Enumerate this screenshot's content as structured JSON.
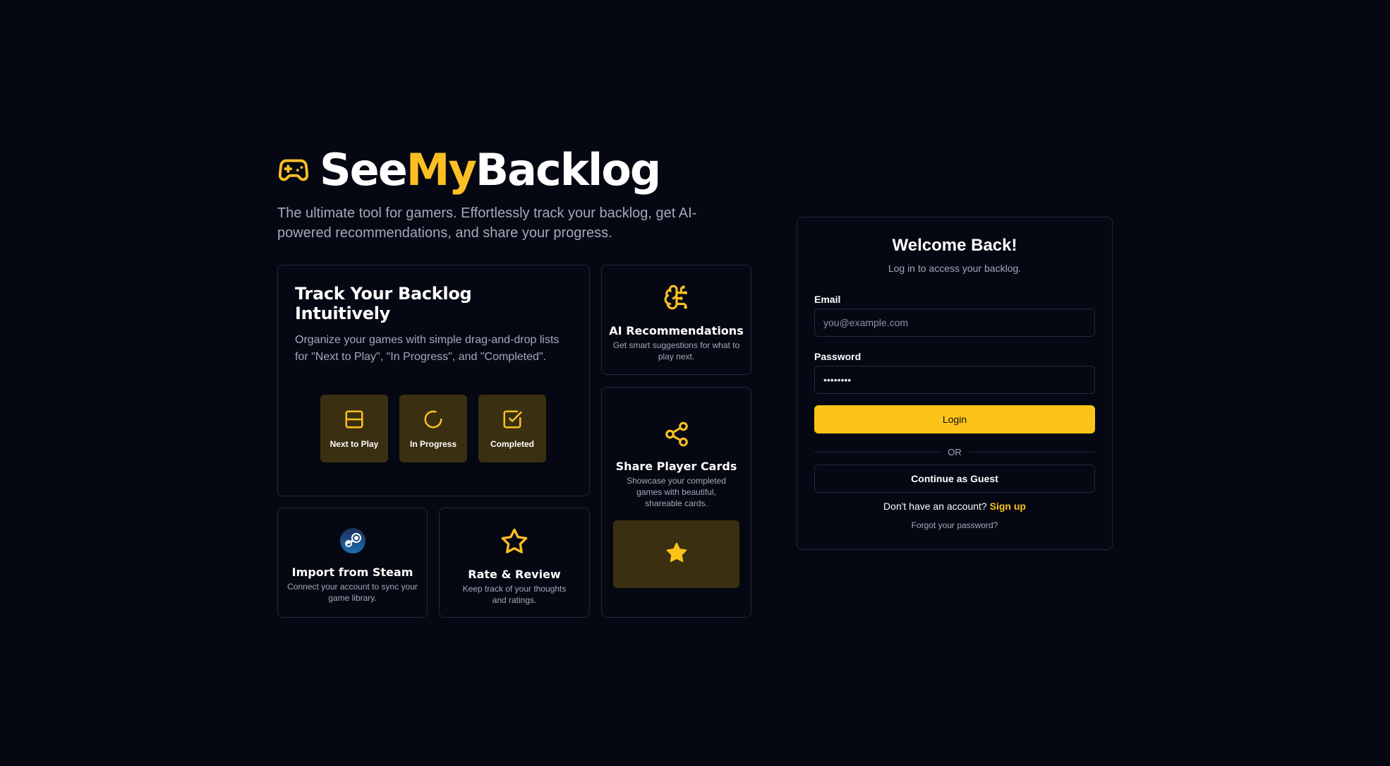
{
  "brand": {
    "name_part1": "See",
    "name_part2": "My",
    "name_part3": "Backlog",
    "tagline": "The ultimate tool for gamers. Effortlessly track your backlog, get AI-powered recommendations, and share your progress.",
    "icon": "gamepad-icon"
  },
  "features": {
    "track": {
      "title": "Track Your Backlog Intuitively",
      "description": "Organize your games with simple drag-and-drop lists for \"Next to Play\", \"In Progress\", and \"Completed\".",
      "statuses": [
        {
          "label": "Next to Play",
          "icon": "layout-rows-icon"
        },
        {
          "label": "In Progress",
          "icon": "spinner-icon"
        },
        {
          "label": "Completed",
          "icon": "checkbox-icon"
        }
      ]
    },
    "ai": {
      "title": "AI Recommendations",
      "description": "Get smart suggestions for what to play next.",
      "icon": "brain-icon"
    },
    "share": {
      "title": "Share Player Cards",
      "description": "Showcase your completed games with beautiful, shareable cards.",
      "icon": "share-icon",
      "preview_icon": "star-filled-icon"
    },
    "steam": {
      "title": "Import from Steam",
      "description": "Connect your account to sync your game library.",
      "icon": "steam-icon"
    },
    "rate": {
      "title": "Rate & Review",
      "description": "Keep track of your thoughts and ratings.",
      "icon": "star-outline-icon"
    }
  },
  "login": {
    "title": "Welcome Back!",
    "subtitle": "Log in to access your backlog.",
    "email_label": "Email",
    "email_placeholder": "you@example.com",
    "password_label": "Password",
    "password_value": "••••••••",
    "login_button": "Login",
    "divider_text": "OR",
    "guest_button": "Continue as Guest",
    "signup_prompt": "Don't have an account?",
    "signup_link": "Sign up",
    "forgot_link": "Forgot your password?"
  },
  "colors": {
    "background": "#050812",
    "accent": "#fcc419",
    "border": "#23283a",
    "muted_text": "#a3a9b8",
    "tile_bg": "#3a2f10"
  }
}
